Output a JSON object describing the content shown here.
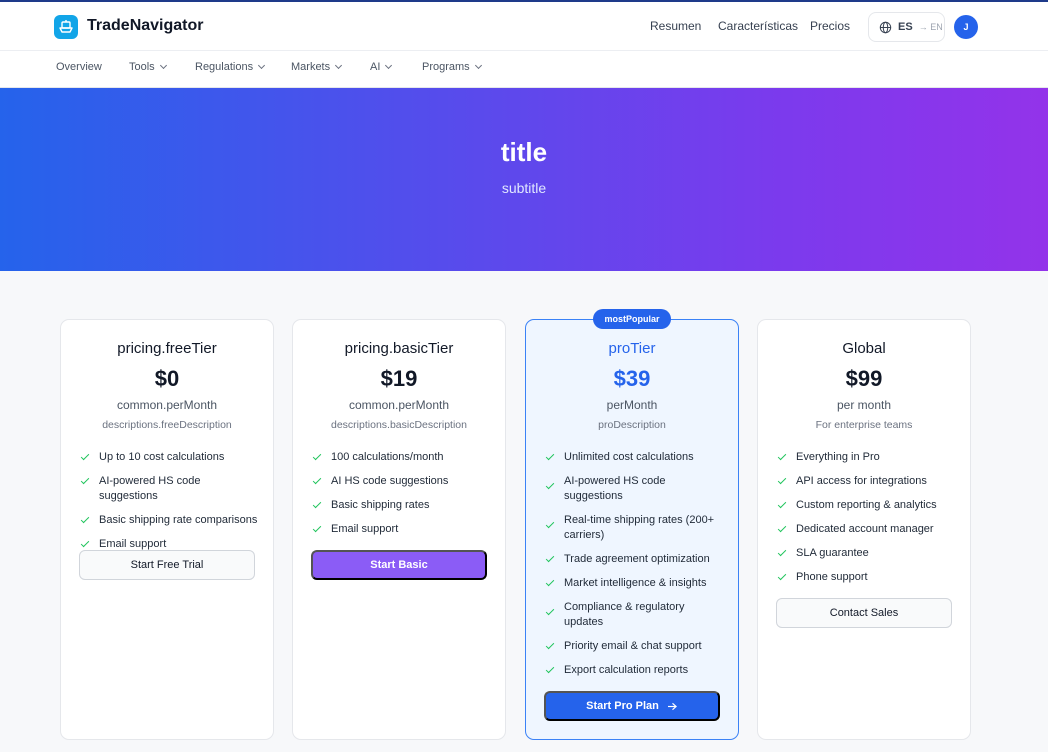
{
  "header": {
    "brand": "TradeNavigator",
    "nav": [
      "Resumen",
      "Características",
      "Precios"
    ],
    "language": {
      "current": "ES",
      "next": "→ EN"
    },
    "avatar_initial": "J"
  },
  "subnav": [
    {
      "label": "Overview"
    },
    {
      "label": "Tools"
    },
    {
      "label": "Regulations"
    },
    {
      "label": "Markets"
    },
    {
      "label": "AI"
    },
    {
      "label": "Programs"
    }
  ],
  "hero": {
    "title": "title",
    "subtitle": "subtitle"
  },
  "plans": [
    {
      "tier": "pricing.freeTier",
      "price": "$0",
      "period": "common.perMonth",
      "description": "descriptions.freeDescription",
      "features": [
        "Up to 10 cost calculations",
        "AI-powered HS code suggestions",
        "Basic shipping rate comparisons",
        "Email support"
      ],
      "cta": "Start Free Trial"
    },
    {
      "tier": "pricing.basicTier",
      "price": "$19",
      "period": "common.perMonth",
      "description": "descriptions.basicDescription",
      "features": [
        "100 calculations/month",
        "AI HS code suggestions",
        "Basic shipping rates",
        "Email support"
      ],
      "cta": "Start Basic"
    },
    {
      "badge": "mostPopular",
      "tier": "proTier",
      "price": "$39",
      "period": "perMonth",
      "description": "proDescription",
      "features": [
        "Unlimited cost calculations",
        "AI-powered HS code suggestions",
        "Real-time shipping rates (200+ carriers)",
        "Trade agreement optimization",
        "Market intelligence & insights",
        "Compliance & regulatory updates",
        "Priority email & chat support",
        "Export calculation reports"
      ],
      "cta": "Start Pro Plan",
      "cta_icon": "arrow-right-icon"
    },
    {
      "tier": "Global",
      "price": "$99",
      "period": "per month",
      "description": "For enterprise teams",
      "features": [
        "Everything in Pro",
        "API access for integrations",
        "Custom reporting & analytics",
        "Dedicated account manager",
        "SLA guarantee",
        "Phone support"
      ],
      "cta": "Contact Sales"
    }
  ],
  "colors": {
    "accent": "#2563eb",
    "purple_button": "#8b5cf6",
    "check": "#22c55e",
    "hero_gradient_start": "#2563eb",
    "hero_gradient_end": "#9333ea"
  }
}
